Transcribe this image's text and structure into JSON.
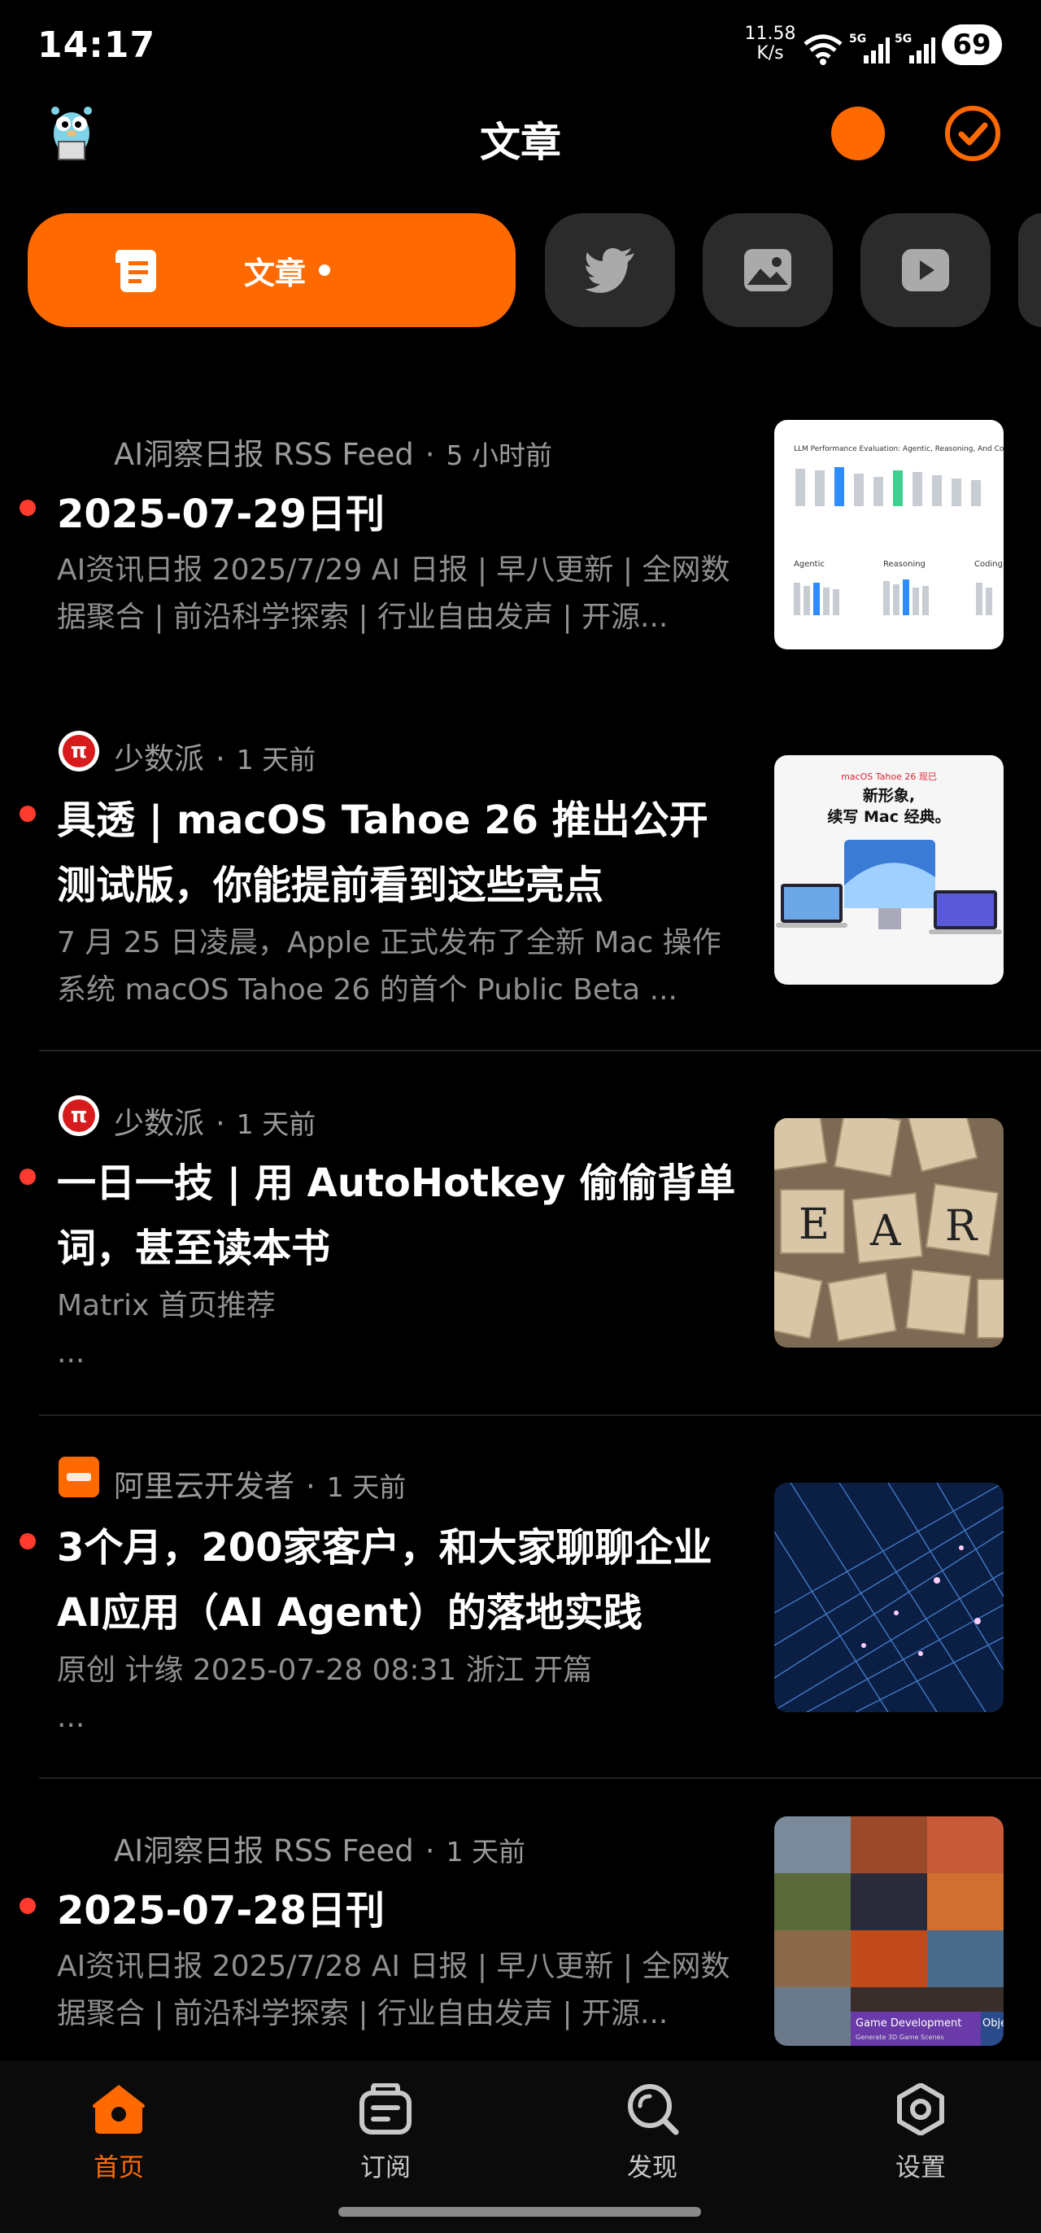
{
  "status": {
    "time": "14:17",
    "net_speed": "11.58",
    "net_unit": "K/s",
    "battery": "69"
  },
  "header": {
    "title": "文章"
  },
  "tabs": {
    "active_label": "文章",
    "icons": [
      "twitter-icon",
      "image-icon",
      "video-icon"
    ]
  },
  "articles": [
    {
      "source": "AI洞察日报 RSS Feed",
      "time": "5 小时前",
      "title": "2025-07-29日刊",
      "excerpt": "AI资讯日报 2025/7/29 AI 日报 | 早八更新 | 全网数据聚合 | 前沿科学探索 | 行业自由发声 | 开源...",
      "unread": true
    },
    {
      "source": "少数派",
      "time": "1 天前",
      "title": "具透 | macOS Tahoe 26 推出公开测试版，你能提前看到这些亮点",
      "excerpt": "7 月 25 日凌晨，Apple 正式发布了全新 Mac 操作系统 macOS Tahoe 26 的首个 Public Beta ...",
      "unread": true
    },
    {
      "source": "少数派",
      "time": "1 天前",
      "title": "一日一技 | 用 AutoHotkey 偷偷背单词，甚至读本书",
      "excerpt": "Matrix 首页推荐",
      "excerpt2": "...",
      "unread": true
    },
    {
      "source": "阿里云开发者",
      "time": "1 天前",
      "title": "3个月，200家客户，和大家聊聊企业AI应用（AI Agent）的落地实践",
      "excerpt": "原创 计缘 2025-07-28 08:31 浙江 开篇",
      "excerpt2": "...",
      "unread": true
    },
    {
      "source": "AI洞察日报 RSS Feed",
      "time": "1 天前",
      "title": "2025-07-28日刊",
      "excerpt": "AI资讯日报 2025/7/28 AI 日报 | 早八更新 | 全网数据聚合 | 前沿科学探索 | 行业自由发声 | 开源...",
      "unread": true
    }
  ],
  "thumbs": {
    "chart_title": "LLM Performance Evaluation: Agentic, Reasoning, And Coding Be",
    "chart_labels": [
      "Agentic",
      "Reasoning",
      "Coding"
    ],
    "mac_badge": "macOS Tahoe 26 现已",
    "mac_line1": "新形象,",
    "mac_line2": "续写 Mac 经典。",
    "tiles": [
      "E",
      "A",
      "R"
    ],
    "game_label": "Game Development",
    "game_sub": "Generate 3D Game Scenes",
    "game_label2": "Obje"
  },
  "nav": [
    {
      "label": "首页",
      "icon": "home-icon",
      "active": true
    },
    {
      "label": "订阅",
      "icon": "subscribe-icon",
      "active": false
    },
    {
      "label": "发现",
      "icon": "discover-icon",
      "active": false
    },
    {
      "label": "设置",
      "icon": "settings-icon",
      "active": false
    }
  ],
  "colors": {
    "accent": "#ff6a00",
    "unread_dot": "#ff3a2e",
    "background": "#000000"
  }
}
